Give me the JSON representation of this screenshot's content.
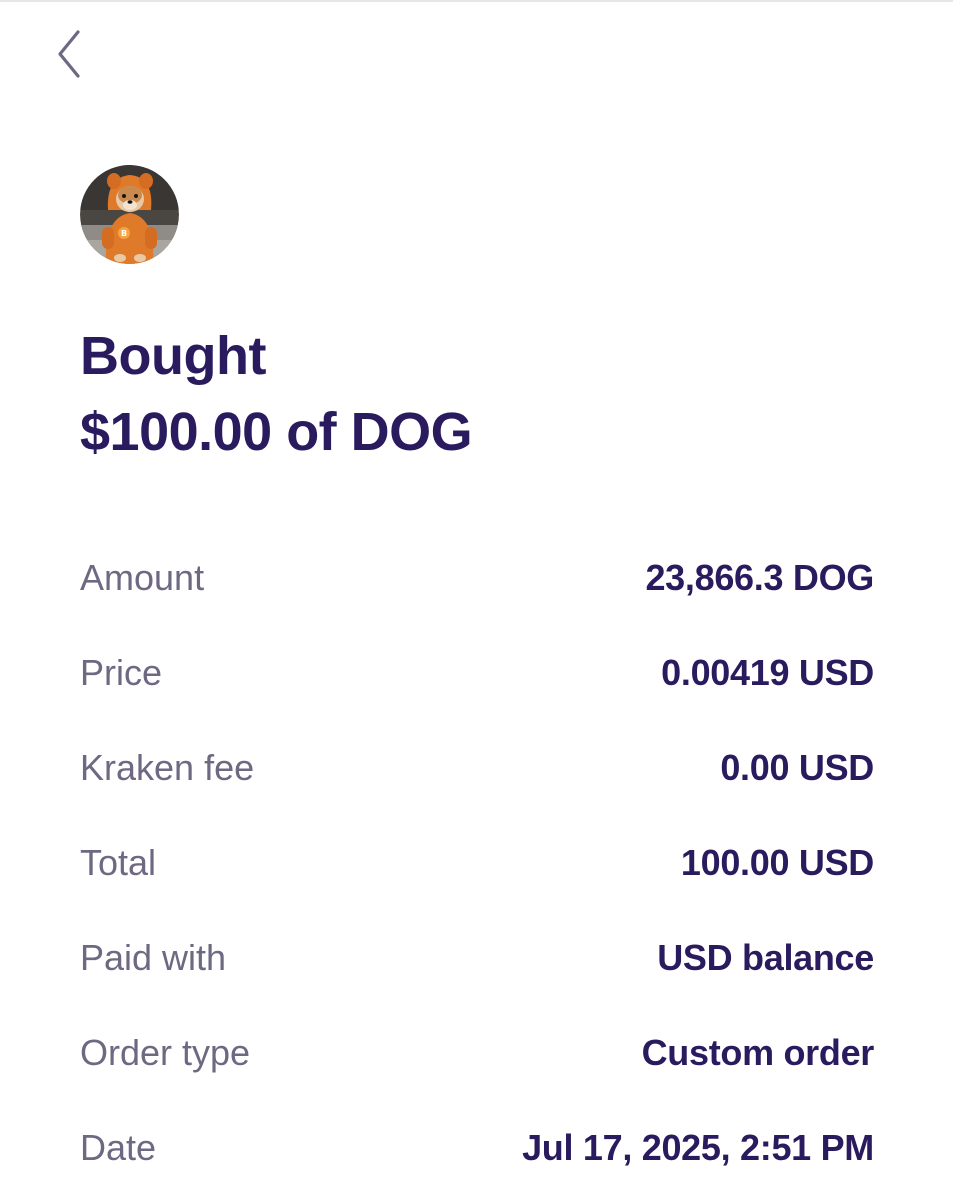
{
  "nav": {
    "back_icon": "chevron-left-icon"
  },
  "asset": {
    "avatar_description": "dog-in-orange-hoodie-avatar",
    "symbol": "DOG"
  },
  "headline": {
    "line1": "Bought",
    "line2": "$100.00 of DOG"
  },
  "details": [
    {
      "label": "Amount",
      "value": "23,866.3 DOG"
    },
    {
      "label": "Price",
      "value": "0.00419 USD"
    },
    {
      "label": "Kraken fee",
      "value": "0.00 USD"
    },
    {
      "label": "Total",
      "value": "100.00 USD"
    },
    {
      "label": "Paid with",
      "value": "USD balance"
    },
    {
      "label": "Order type",
      "value": "Custom order"
    },
    {
      "label": "Date",
      "value": "Jul 17, 2025, 2:51 PM"
    }
  ],
  "colors": {
    "primary_text": "#2a1a5e",
    "secondary_text": "#6e6882",
    "hoodie_orange": "#e07a2b"
  }
}
